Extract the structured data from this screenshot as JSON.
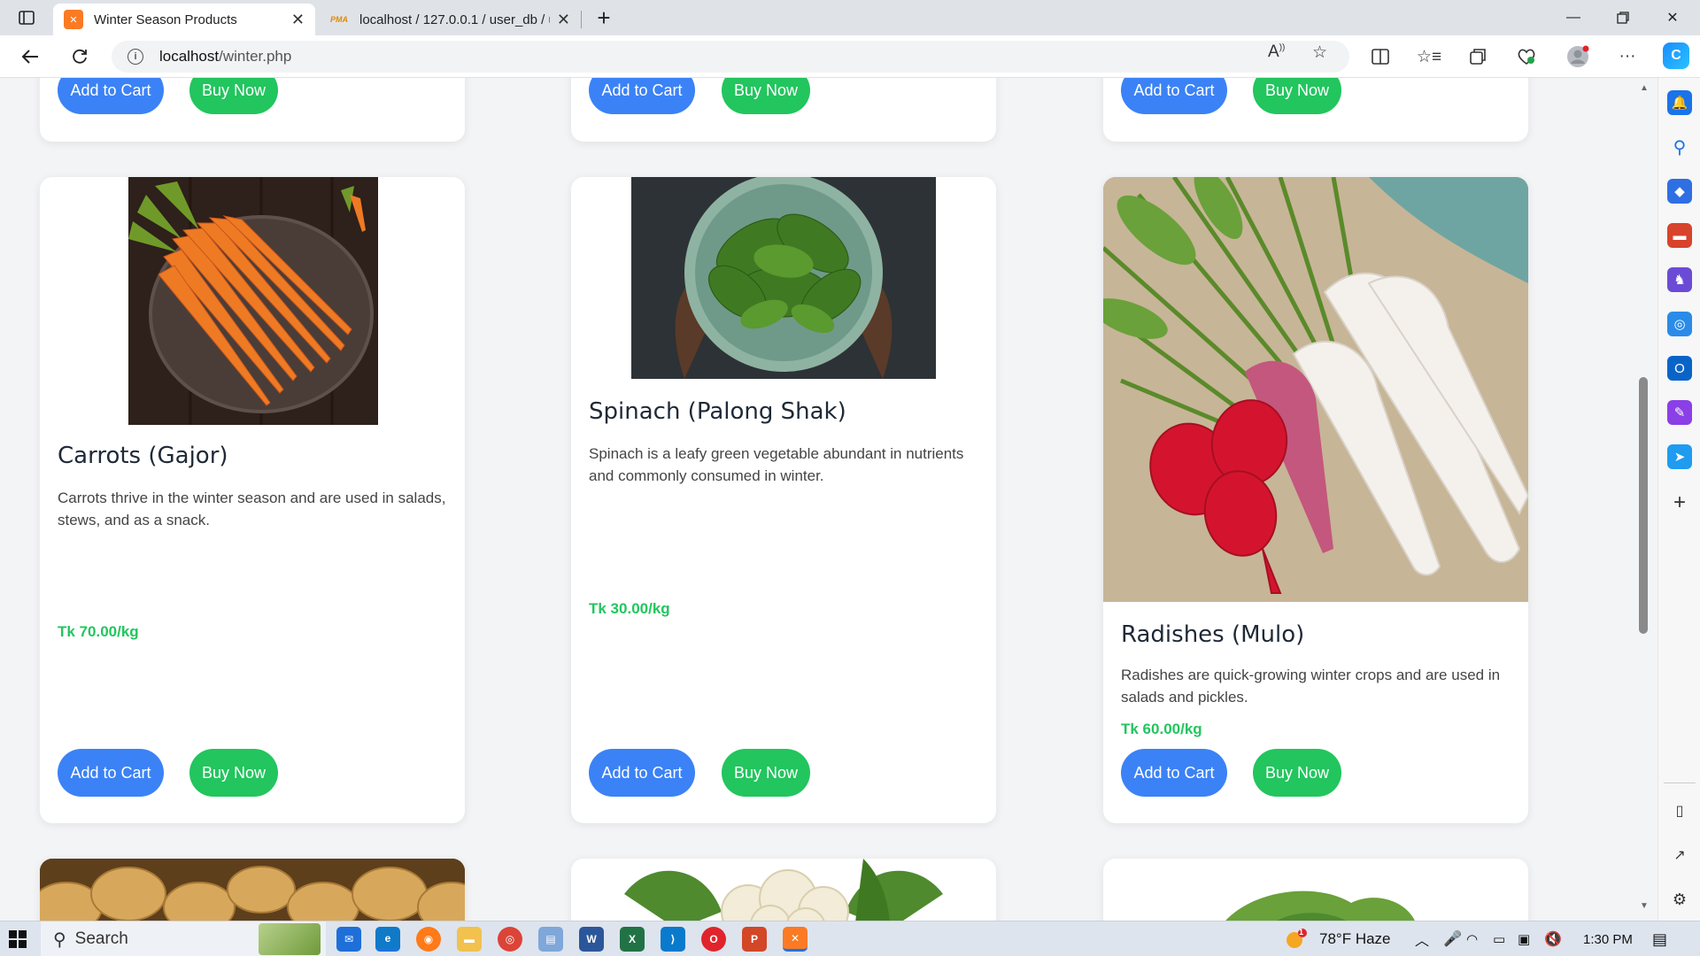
{
  "browser": {
    "tabs": [
      {
        "title": "Winter Season Products",
        "active": true,
        "icon": "xampp-icon"
      },
      {
        "title": "localhost / 127.0.0.1 / user_db / u",
        "active": false,
        "icon": "phpmyadmin-icon"
      }
    ],
    "url_host": "localhost",
    "url_path": "/winter.php"
  },
  "top_row_buttons": {
    "add_to_cart": "Add to Cart",
    "buy_now": "Buy Now"
  },
  "products": [
    {
      "name": "Carrots (Gajor)",
      "description": "Carrots thrive in the winter season and are used in salads, stews, and as a snack.",
      "price": "Tk 70.00/kg",
      "add_to_cart": "Add to Cart",
      "buy_now": "Buy Now",
      "image": "carrots-image"
    },
    {
      "name": "Spinach (Palong Shak)",
      "description": "Spinach is a leafy green vegetable abundant in nutrients and commonly consumed in winter.",
      "price": "Tk 30.00/kg",
      "add_to_cart": "Add to Cart",
      "buy_now": "Buy Now",
      "image": "spinach-image"
    },
    {
      "name": "Radishes (Mulo)",
      "description": "Radishes are quick-growing winter crops and are used in salads and pickles.",
      "price": "Tk 60.00/kg",
      "add_to_cart": "Add to Cart",
      "buy_now": "Buy Now",
      "image": "radish-image"
    }
  ],
  "bottom_row_images": [
    "potatoes-image",
    "cauliflower-image",
    "cabbage-image"
  ],
  "taskbar": {
    "search_label": "Search",
    "weather": "78°F  Haze",
    "weather_badge": "1",
    "time": "1:30 PM"
  },
  "colors": {
    "add_to_cart": "#3b82f6",
    "buy_now": "#22c55e",
    "price": "#22c55e",
    "page_bg": "#f3f4f6"
  }
}
